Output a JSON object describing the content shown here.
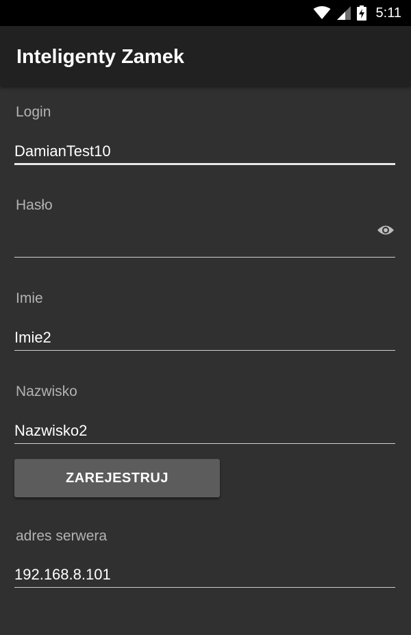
{
  "status_bar": {
    "time": "5:11"
  },
  "toolbar": {
    "title": "Inteligenty Zamek"
  },
  "form": {
    "login": {
      "label": "Login",
      "value": "DamianTest10"
    },
    "password": {
      "label": "Hasło",
      "value": ""
    },
    "first_name": {
      "label": "Imie",
      "value": "Imie2"
    },
    "last_name": {
      "label": "Nazwisko",
      "value": "Nazwisko2"
    },
    "register_button": "ZAREJESTRUJ",
    "server": {
      "label": "adres serwera",
      "value": "192.168.8.101"
    }
  }
}
